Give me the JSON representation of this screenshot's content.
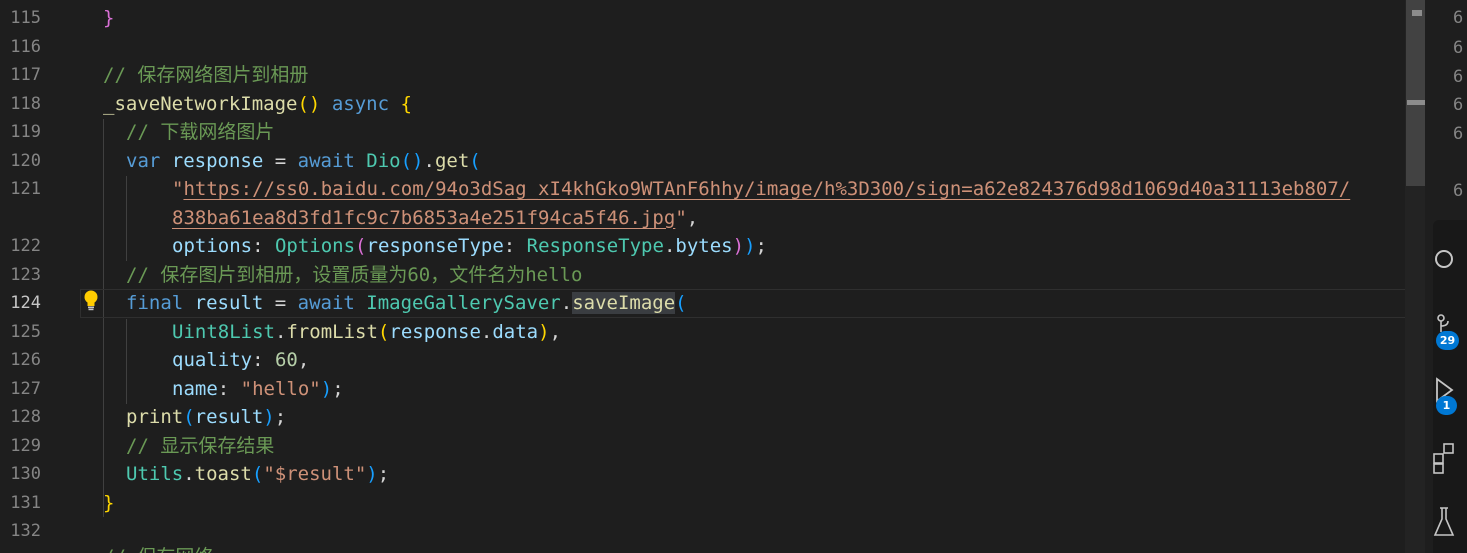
{
  "lines": [
    {
      "num": "115",
      "text": "}"
    },
    {
      "num": "116",
      "text": ""
    },
    {
      "num": "117",
      "text": "// 保存网络图片到相册"
    },
    {
      "num": "118",
      "text": "_saveNetworkImage() async {"
    },
    {
      "num": "119",
      "text": "// 下载网络图片"
    },
    {
      "num": "120",
      "text": "var response = await Dio().get("
    },
    {
      "num": "121",
      "text": "\"https://ss0.baidu.com/94o3dSag_xI4khGko9WTAnF6hhy/image/h%3D300/sign=a62e824376d98d1069d40a31113eb807/"
    },
    {
      "num": "",
      "text": "838ba61ea8d3fd1fc9c7b6853a4e251f94ca5f46.jpg\","
    },
    {
      "num": "122",
      "text": "options: Options(responseType: ResponseType.bytes));"
    },
    {
      "num": "123",
      "text": "// 保存图片到相册，设置质量为60，文件名为hello"
    },
    {
      "num": "124",
      "text": "final result = await ImageGallerySaver.saveImage("
    },
    {
      "num": "125",
      "text": "Uint8List.fromList(response.data),"
    },
    {
      "num": "126",
      "text": "quality: 60,"
    },
    {
      "num": "127",
      "text": "name: \"hello\");"
    },
    {
      "num": "128",
      "text": "print(result);"
    },
    {
      "num": "129",
      "text": "// 显示保存结果"
    },
    {
      "num": "130",
      "text": "Utils.toast(\"$result\");"
    },
    {
      "num": "131",
      "text": "}"
    },
    {
      "num": "132",
      "text": ""
    },
    {
      "num": "",
      "text": "// 保存网络..."
    }
  ],
  "tokens": {
    "close_brace": "}",
    "comment_save_network": "// 保存网络图片到相册",
    "fn_save_network": "_saveNetworkImage",
    "kw_async": "async",
    "comment_download": "// 下载网络图片",
    "kw_var": "var",
    "var_response": "response",
    "kw_await": "await",
    "type_dio": "Dio",
    "fn_get": "get",
    "url_part1": "https://ss0.baidu.com/94o3dSag_xI4khGko9WTAnF6hhy/image/h%3D300/sign=a62e824376d98d1069d40a31113eb807/",
    "url_part2": "838ba61ea8d3fd1fc9c7b6853a4e251f94ca5f46.jpg",
    "param_options": "options",
    "type_options": "Options",
    "param_response_type": "responseType",
    "type_response_type": "ResponseType",
    "prop_bytes": "bytes",
    "comment_save_image": "// 保存图片到相册，设置质量为60，文件名为hello",
    "kw_final": "final",
    "var_result": "result",
    "type_saver": "ImageGallerySaver",
    "fn_save_image": "saveImage",
    "type_uint8list": "Uint8List",
    "fn_from_list": "fromList",
    "prop_data": "data",
    "param_quality": "quality",
    "num_quality": "60",
    "param_name": "name",
    "str_hello": "\"hello\"",
    "fn_print": "print",
    "comment_show_result": "// 显示保存结果",
    "type_utils": "Utils",
    "fn_toast": "toast",
    "str_result": "\"$result\"",
    "comment_next": "// 保存网络..."
  },
  "minimap_digits": [
    "6",
    "6",
    "6",
    "6",
    "6",
    "6"
  ],
  "activity_badges": {
    "source_control": "29",
    "run_debug": "1"
  },
  "colors": {
    "background": "#1e1e1e",
    "comment": "#6a9955",
    "keyword": "#569cd6",
    "function": "#dcdcaa",
    "type": "#4ec9b0",
    "variable": "#9cdcfe",
    "string": "#ce9178",
    "number": "#b5cea8",
    "badge": "#0078d4"
  }
}
